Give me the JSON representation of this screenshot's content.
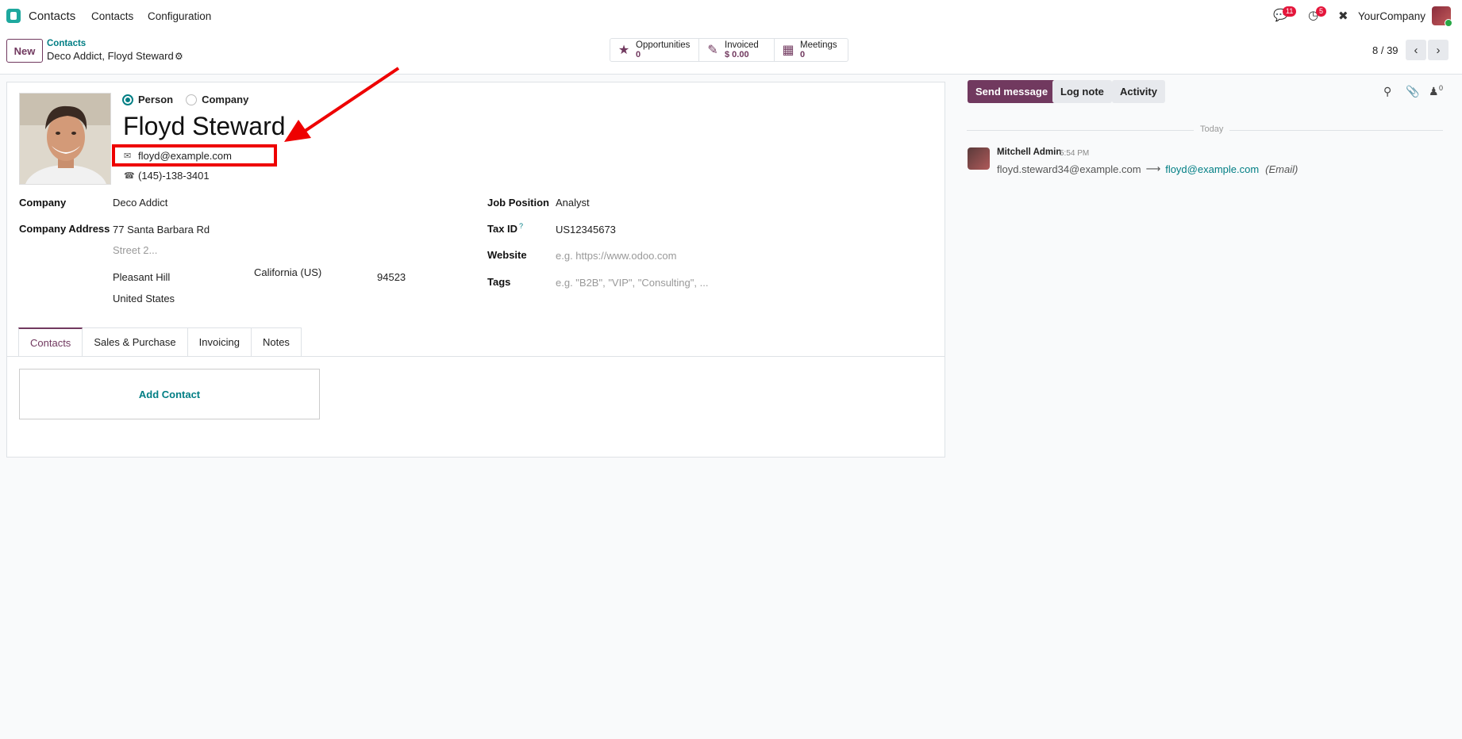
{
  "navbar": {
    "app_name": "Contacts",
    "menus": [
      "Contacts",
      "Configuration"
    ],
    "messages_count": "11",
    "activities_count": "5",
    "company": "YourCompany"
  },
  "control": {
    "new_label": "New",
    "breadcrumb_parent": "Contacts",
    "breadcrumb_current": "Deco Addict, Floyd Steward",
    "smart_buttons": [
      {
        "label": "Opportunities",
        "value": "0",
        "icon": "star-icon"
      },
      {
        "label": "Invoiced",
        "value": "$ 0.00",
        "icon": "edit-icon"
      },
      {
        "label": "Meetings",
        "value": "0",
        "icon": "calendar-icon"
      }
    ],
    "pager": "8 / 39"
  },
  "form": {
    "type_person": "Person",
    "type_company": "Company",
    "name": "Floyd Steward",
    "email": "floyd@example.com",
    "phone": "(145)-138-3401",
    "company_label": "Company",
    "company_value": "Deco Addict",
    "address_label": "Company Address",
    "street": "77 Santa Barbara Rd",
    "street2_placeholder": "Street 2...",
    "city": "Pleasant Hill",
    "state": "California (US)",
    "zip": "94523",
    "country": "United States",
    "job_label": "Job Position",
    "job_value": "Analyst",
    "tax_label": "Tax ID",
    "tax_help": "?",
    "tax_value": "US12345673",
    "website_label": "Website",
    "website_placeholder": "e.g. https://www.odoo.com",
    "tags_label": "Tags",
    "tags_placeholder": "e.g. \"B2B\", \"VIP\", \"Consulting\", ..."
  },
  "tabs": [
    "Contacts",
    "Sales & Purchase",
    "Invoicing",
    "Notes"
  ],
  "add_contact": "Add Contact",
  "chatter": {
    "send_message": "Send message",
    "log_note": "Log note",
    "activity": "Activity",
    "followers_count": "0",
    "today": "Today",
    "author": "Mitchell Admin",
    "time": "5:54 PM",
    "old_email": "floyd.steward34@example.com",
    "new_email": "floyd@example.com",
    "field_name": "(Email)"
  },
  "colors": {
    "primary": "#71395f",
    "link": "#017e84",
    "annotation": "#e00000"
  }
}
